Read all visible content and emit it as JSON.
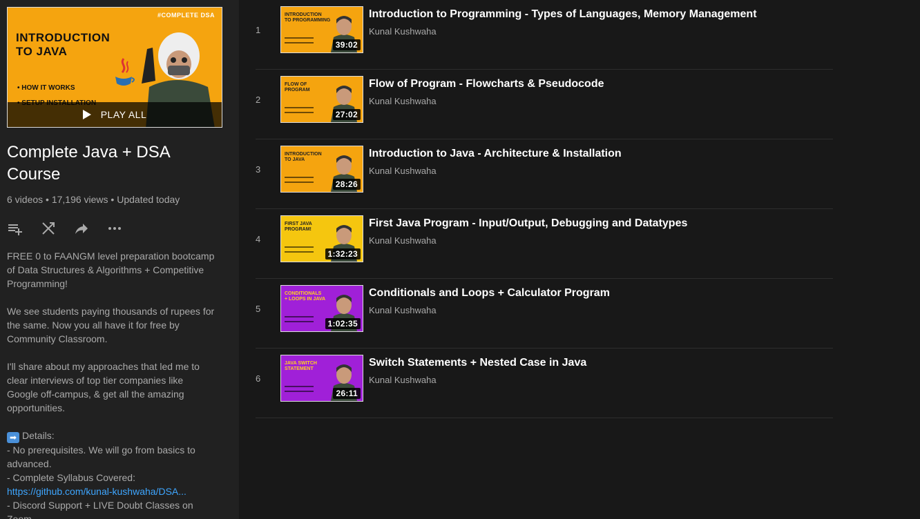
{
  "playlist": {
    "hero": {
      "tag": "#COMPLETE DSA",
      "title_line1": "INTRODUCTION",
      "title_line2": "TO JAVA",
      "bullet1": "• HOW IT WORKS",
      "bullet2": "• SETUP INSTALLATION"
    },
    "play_all_label": "PLAY ALL",
    "title_line1": "Complete Java + DSA",
    "title_line2": "Course",
    "stats": "6 videos • 17,196 views • Updated today",
    "actions": [
      "add-to-queue-icon",
      "shuffle-icon",
      "share-icon",
      "more-icon"
    ],
    "description": {
      "p1": [
        "FREE 0 to FAANGM level preparation bootcamp",
        "of Data Structures & Algorithms + Competitive",
        "Programming!"
      ],
      "p2": [
        "We see students paying thousands of rupees for",
        "the same. Now you all have it for free by",
        "Community Classroom."
      ],
      "p3": [
        "I'll share about my approaches that led me to",
        "clear interviews of top tier companies like",
        "Google off-campus, & get all the amazing",
        "opportunities."
      ],
      "details_label": "Details:",
      "d1": "- No prerequisites. We will go from basics to",
      "d2": "advanced.",
      "d3": "- Complete Syllabus Covered:",
      "link": "https://github.com/kunal-kushwaha/DSA...",
      "d4": "- Discord Support + LIVE Doubt Classes on",
      "d5": "Zoom"
    }
  },
  "videos": [
    {
      "index": "1",
      "title": "Introduction to Programming - Types of Languages, Memory Management",
      "channel": "Kunal Kushwaha",
      "duration": "39:02",
      "thumb_text": [
        "INTRODUCTION",
        "TO PROGRAMMING"
      ],
      "thumb_bg": "#f5a40f"
    },
    {
      "index": "2",
      "title": "Flow of Program - Flowcharts & Pseudocode",
      "channel": "Kunal Kushwaha",
      "duration": "27:02",
      "thumb_text": [
        "FLOW OF",
        "PROGRAM"
      ],
      "thumb_bg": "#f5a40f"
    },
    {
      "index": "3",
      "title": "Introduction to Java - Architecture & Installation",
      "channel": "Kunal Kushwaha",
      "duration": "28:26",
      "thumb_text": [
        "INTRODUCTION",
        "TO JAVA"
      ],
      "thumb_bg": "#f5a40f"
    },
    {
      "index": "4",
      "title": "First Java Program - Input/Output, Debugging and Datatypes",
      "channel": "Kunal Kushwaha",
      "duration": "1:32:23",
      "thumb_text": [
        "FIRST JAVA",
        "PROGRAM!"
      ],
      "thumb_bg": "#f5c60f"
    },
    {
      "index": "5",
      "title": "Conditionals and Loops + Calculator Program",
      "channel": "Kunal Kushwaha",
      "duration": "1:02:35",
      "thumb_text": [
        "CONDITIONALS",
        "+ LOOPS IN JAVA"
      ],
      "thumb_bg": "#a020d8"
    },
    {
      "index": "6",
      "title": "Switch Statements + Nested Case in Java",
      "channel": "Kunal Kushwaha",
      "duration": "26:11",
      "thumb_text": [
        "JAVA SWITCH",
        "STATEMENT"
      ],
      "thumb_bg": "#a020d8"
    }
  ],
  "colors": {
    "accent_link": "#3ea6ff",
    "sidebar_bg": "#212121",
    "page_bg": "#181818"
  }
}
